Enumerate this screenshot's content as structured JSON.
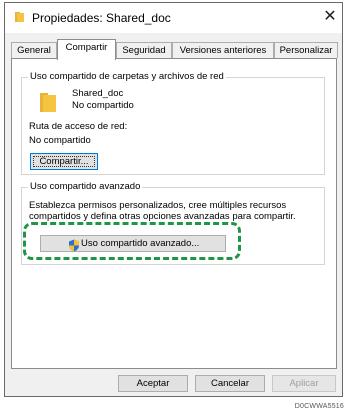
{
  "window": {
    "title": "Propiedades: Shared_doc",
    "close_label": "✕"
  },
  "tabs": [
    {
      "label": "General",
      "active": false
    },
    {
      "label": "Compartir",
      "active": true
    },
    {
      "label": "Seguridad",
      "active": false
    },
    {
      "label": "Versiones anteriores",
      "active": false
    },
    {
      "label": "Personalizar",
      "active": false
    }
  ],
  "network_sharing": {
    "title": "Uso compartido de carpetas y archivos de red",
    "folder_name": "Shared_doc",
    "folder_status": "No compartido",
    "path_label": "Ruta de acceso de red:",
    "path_value": "No compartido",
    "share_button": "Compartir..."
  },
  "advanced_sharing": {
    "title": "Uso compartido avanzado",
    "description_line1": "Establezca permisos personalizados, cree múltiples recursos",
    "description_line2": "compartidos y defina otras opciones avanzadas para compartir.",
    "button": "Uso compartido avanzado..."
  },
  "footer": {
    "ok": "Aceptar",
    "cancel": "Cancelar",
    "apply": "Aplicar"
  },
  "caption": "D0CWWA5516",
  "colors": {
    "highlight": "#1e9646",
    "folder": "#f5c542"
  }
}
